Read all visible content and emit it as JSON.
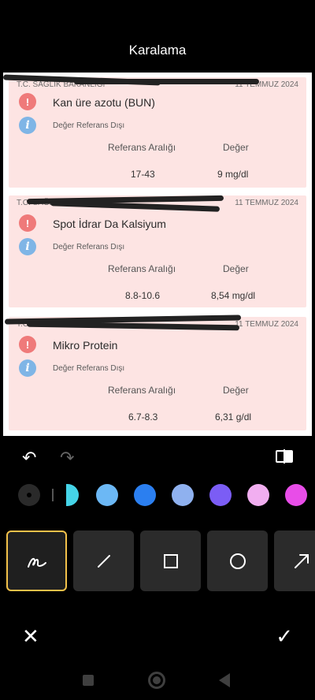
{
  "header": {
    "title": "Karalama"
  },
  "records": [
    {
      "institution": "T.C. SAĞLIK BAKANLIĞI",
      "date": "11 TEMMUZ 2024",
      "test": "Kan üre azotu (BUN)",
      "status": "Değer Referans Dışı",
      "range_label": "Referans Aralığı",
      "value_label": "Değer",
      "range": "17-43",
      "value": "9 mg/dl"
    },
    {
      "institution": "T.C. SAĞLIK BAKANLIĞI",
      "date": "11 TEMMUZ 2024",
      "test": "Spot İdrar Da Kalsiyum",
      "status": "Değer Referans Dışı",
      "range_label": "Referans Aralığı",
      "value_label": "Değer",
      "range": "8.8-10.6",
      "value": "8,54 mg/dl"
    },
    {
      "institution": "T.C. SAĞLIK BAKANLIĞI",
      "date": "11 TEMMUZ 2024",
      "test": "Mikro Protein",
      "status": "Değer Referans Dışı",
      "range_label": "Referans Aralığı",
      "value_label": "Değer",
      "range": "6.7-8.3",
      "value": "6,31 g/dl"
    }
  ],
  "toolbar": {
    "undo_icon": "undo-icon",
    "redo_icon": "redo-icon",
    "compare_icon": "compare-icon"
  },
  "colors": [
    "#45d4e8",
    "#6cb8f5",
    "#2b7ff0",
    "#8fb1ef",
    "#7b5df5",
    "#f1aef0",
    "#e84de8"
  ],
  "tools": [
    "freehand",
    "line",
    "rectangle",
    "circle",
    "arrow"
  ],
  "actions": {
    "cancel_icon": "close-icon",
    "confirm_icon": "check-icon"
  }
}
